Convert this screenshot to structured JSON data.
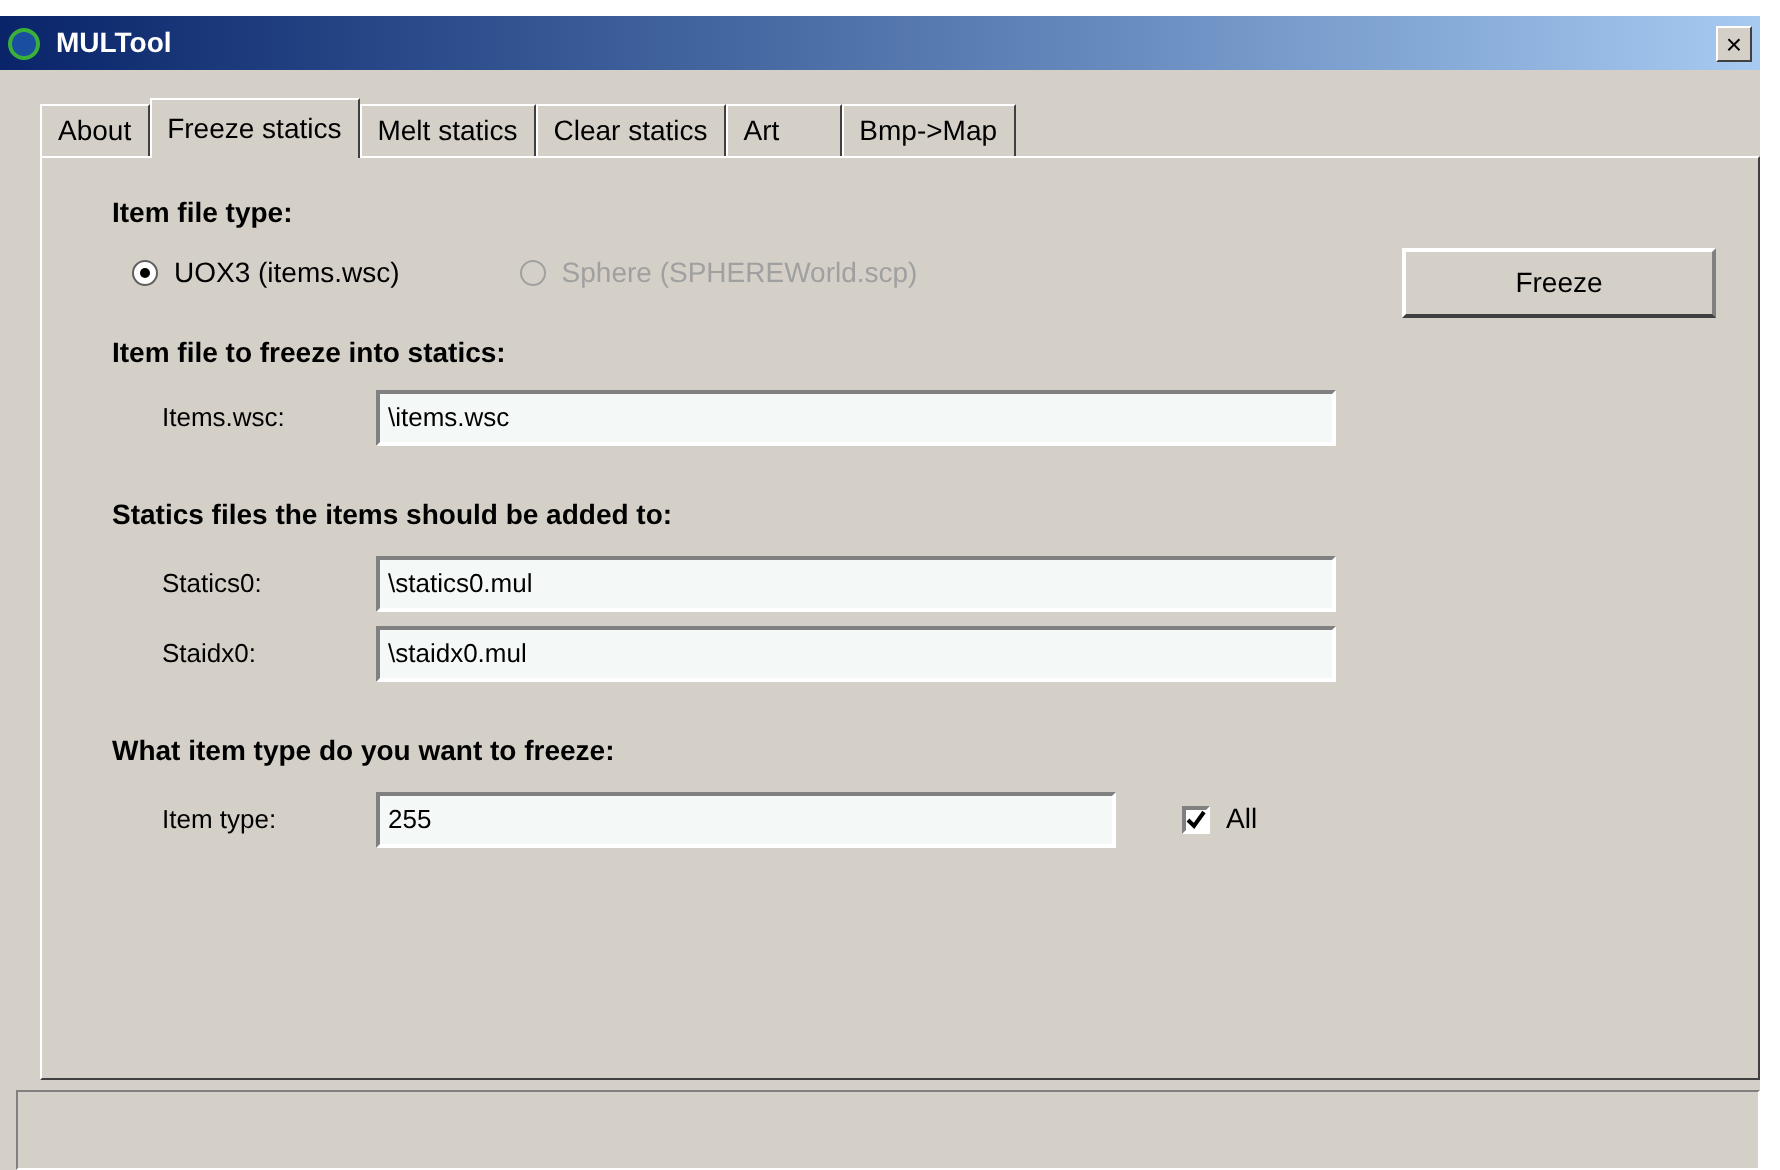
{
  "window": {
    "title": "MULTool",
    "close": "×"
  },
  "tabs": [
    {
      "label": "About",
      "selected": false
    },
    {
      "label": "Freeze statics",
      "selected": true
    },
    {
      "label": "Melt statics",
      "selected": false
    },
    {
      "label": "Clear statics",
      "selected": false
    },
    {
      "label": "Art",
      "selected": false
    },
    {
      "label": "Bmp->Map",
      "selected": false
    }
  ],
  "item_file_type": {
    "heading": "Item file type:",
    "options": [
      {
        "label": "UOX3 (items.wsc)",
        "selected": true,
        "disabled": false
      },
      {
        "label": "Sphere (SPHEREWorld.scp)",
        "selected": false,
        "disabled": true
      }
    ]
  },
  "freeze_button": "Freeze",
  "item_file": {
    "heading": "Item file to freeze into statics:",
    "fields": [
      {
        "label": "Items.wsc:",
        "value": "\\items.wsc"
      }
    ]
  },
  "statics_files": {
    "heading": "Statics files the items should be added to:",
    "fields": [
      {
        "label": "Statics0:",
        "value": "\\statics0.mul"
      },
      {
        "label": "Staidx0:",
        "value": "\\staidx0.mul"
      }
    ]
  },
  "item_type": {
    "heading": "What item type do you want to freeze:",
    "label": "Item type:",
    "value": "255",
    "all": {
      "label": "All",
      "checked": true
    }
  }
}
